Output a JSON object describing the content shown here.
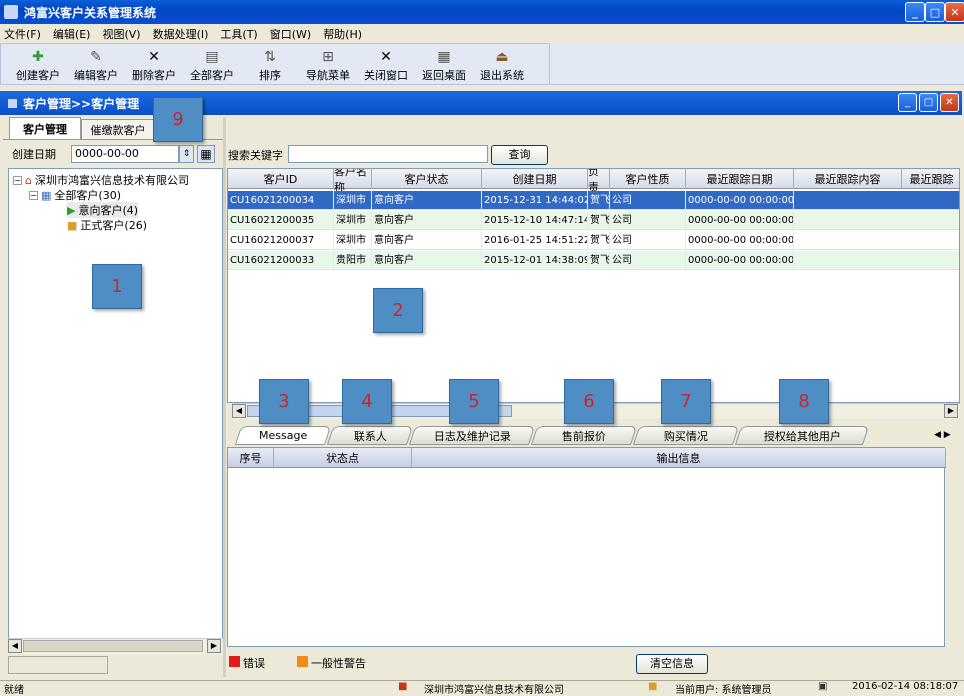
{
  "window": {
    "title": "鸿富兴客户关系管理系统",
    "min": "_",
    "max": "□",
    "close": "✕"
  },
  "menu": [
    "文件(F)",
    "编辑(E)",
    "视图(V)",
    "数据处理(I)",
    "工具(T)",
    "窗口(W)",
    "帮助(H)"
  ],
  "toolbar": [
    {
      "label": "创建客户",
      "icon": "plus-icon",
      "glyph": "✚",
      "color": "#2f9c2f"
    },
    {
      "label": "编辑客户",
      "icon": "edit-icon",
      "glyph": "✎",
      "color": "#555555"
    },
    {
      "label": "删除客户",
      "icon": "delete-icon",
      "glyph": "✕",
      "color": "#000000"
    },
    {
      "label": "全部客户",
      "icon": "list-icon",
      "glyph": "▤",
      "color": "#555555"
    },
    {
      "label": "排序",
      "icon": "sort-icon",
      "glyph": "⇅",
      "color": "#555555"
    },
    {
      "label": "导航菜单",
      "icon": "nav-icon",
      "glyph": "⊞",
      "color": "#555555"
    },
    {
      "label": "关闭窗口",
      "icon": "close-icon",
      "glyph": "✕",
      "color": "#000000"
    },
    {
      "label": "返回桌面",
      "icon": "desktop-icon",
      "glyph": "▦",
      "color": "#555555"
    },
    {
      "label": "退出系统",
      "icon": "exit-icon",
      "glyph": "⏏",
      "color": "#8a5a2a"
    }
  ],
  "child_window": {
    "title": "客户管理>>客户管理"
  },
  "left_tabs": [
    "客户管理",
    "催缴款客户"
  ],
  "filter": {
    "label": "创建日期",
    "value": "0000-00-00",
    "spin": "⇕"
  },
  "search": {
    "label": "搜索关键字",
    "value": "",
    "button": "查询"
  },
  "tree": {
    "root": "深圳市鸿富兴信息技术有限公司",
    "all": "全部客户(30)",
    "intent": "意向客户(4)",
    "formal": "正式客户(26)"
  },
  "callouts": [
    "1",
    "2",
    "3",
    "4",
    "5",
    "6",
    "7",
    "8",
    "9"
  ],
  "grid": {
    "columns": [
      "客户ID",
      "客户名称",
      "客户状态",
      "创建日期",
      "负责",
      "客户性质",
      "最近跟踪日期",
      "最近跟踪内容",
      "最近跟踪"
    ],
    "rows": [
      [
        "CU16021200034",
        "深圳市",
        "意向客户",
        "2015-12-31 14:44:02",
        "贺飞",
        "公司",
        "0000-00-00 00:00:00"
      ],
      [
        "CU16021200035",
        "深圳市",
        "意向客户",
        "2015-12-10 14:47:14",
        "贺飞",
        "公司",
        "0000-00-00 00:00:00"
      ],
      [
        "CU16021200037",
        "深圳市",
        "意向客户",
        "2016-01-25 14:51:22",
        "贺飞",
        "公司",
        "0000-00-00 00:00:00"
      ],
      [
        "CU16021200033",
        "贵阳市",
        "意向客户",
        "2015-12-01 14:38:09",
        "贺飞",
        "公司",
        "0000-00-00 00:00:00"
      ]
    ]
  },
  "bottom_tabs": [
    "Message",
    "联系人",
    "日志及维护记录",
    "售前报价",
    "购买情况",
    "授权给其他用户"
  ],
  "msg_columns": [
    "序号",
    "状态点",
    "输出信息"
  ],
  "legend": {
    "error": "错误",
    "warning": "一般性警告",
    "clear": "清空信息"
  },
  "status": {
    "ready": "就绪",
    "company": "深圳市鸿富兴信息技术有限公司",
    "user": "当前用户: 系统管理员",
    "datetime": "2016-02-14 08:18:07"
  },
  "colors": {
    "selected_row": "#316ac5",
    "alt_row": "#e8f7e8",
    "callout": "#4e8ec4",
    "callout_text": "#c8262a"
  }
}
